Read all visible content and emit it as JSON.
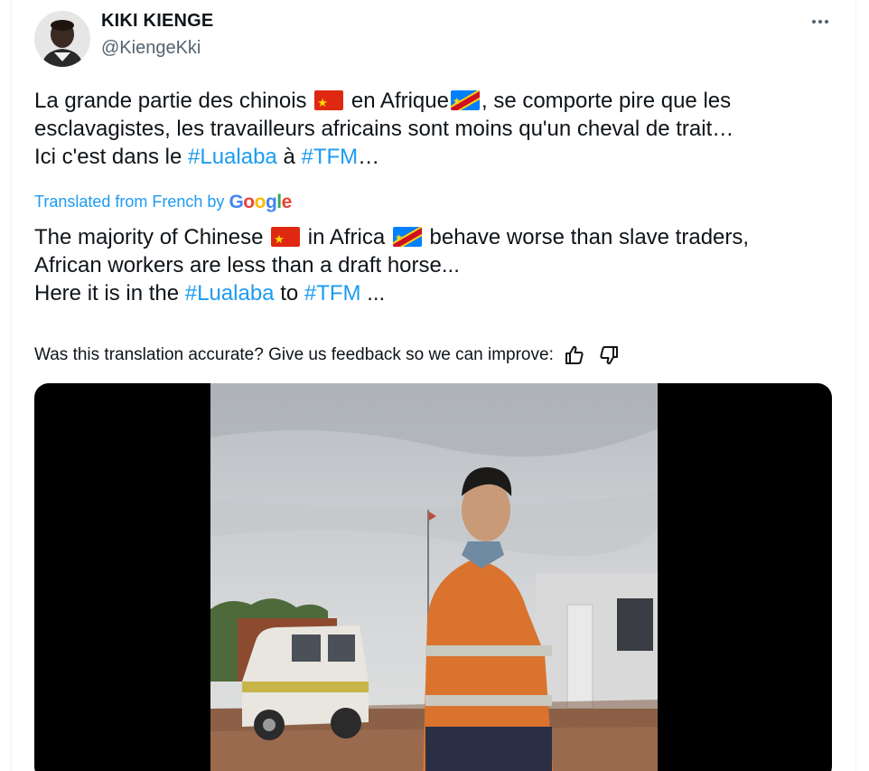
{
  "author": {
    "display_name": "KIKI KIENGE",
    "handle": "@KiengeKki",
    "avatar_icon": "person-avatar"
  },
  "more_icon": "more-dots-icon",
  "tweet": {
    "line1_a": "La grande partie des chinois",
    "line1_b": "en Afrique",
    "line1_c": ", se comporte pire que les",
    "line2": "esclavagistes, les travailleurs africains sont moins qu'un cheval de trait…",
    "line3_a": "Ici c'est dans le",
    "hashtag1": "#Lualaba",
    "line3_b": "à",
    "hashtag2": "#TFM",
    "line3_c": "…"
  },
  "translation_label": {
    "prefix": "Translated from French by",
    "google_G": "G",
    "google_o1": "o",
    "google_o2": "o",
    "google_g": "g",
    "google_l": "l",
    "google_e": "e"
  },
  "translation": {
    "line1_a": "The majority of Chinese",
    "line1_b": "in Africa",
    "line1_c": "behave worse than slave traders,",
    "line2": "African workers are less than a draft horse...",
    "line3_a": "Here it is in the",
    "hashtag1": "#Lualaba",
    "line3_b": "to",
    "hashtag2": "#TFM",
    "line3_c": "..."
  },
  "feedback": {
    "question": "Was this translation accurate? Give us feedback so we can improve:",
    "thumbs_up_icon": "thumbs-up-icon",
    "thumbs_down_icon": "thumbs-down-icon"
  },
  "media": {
    "type": "video",
    "flags": {
      "china": "#de2910",
      "drc": "#007fff"
    },
    "colors": {
      "link": "#1d9bf0",
      "secondary_text": "#536471"
    }
  }
}
